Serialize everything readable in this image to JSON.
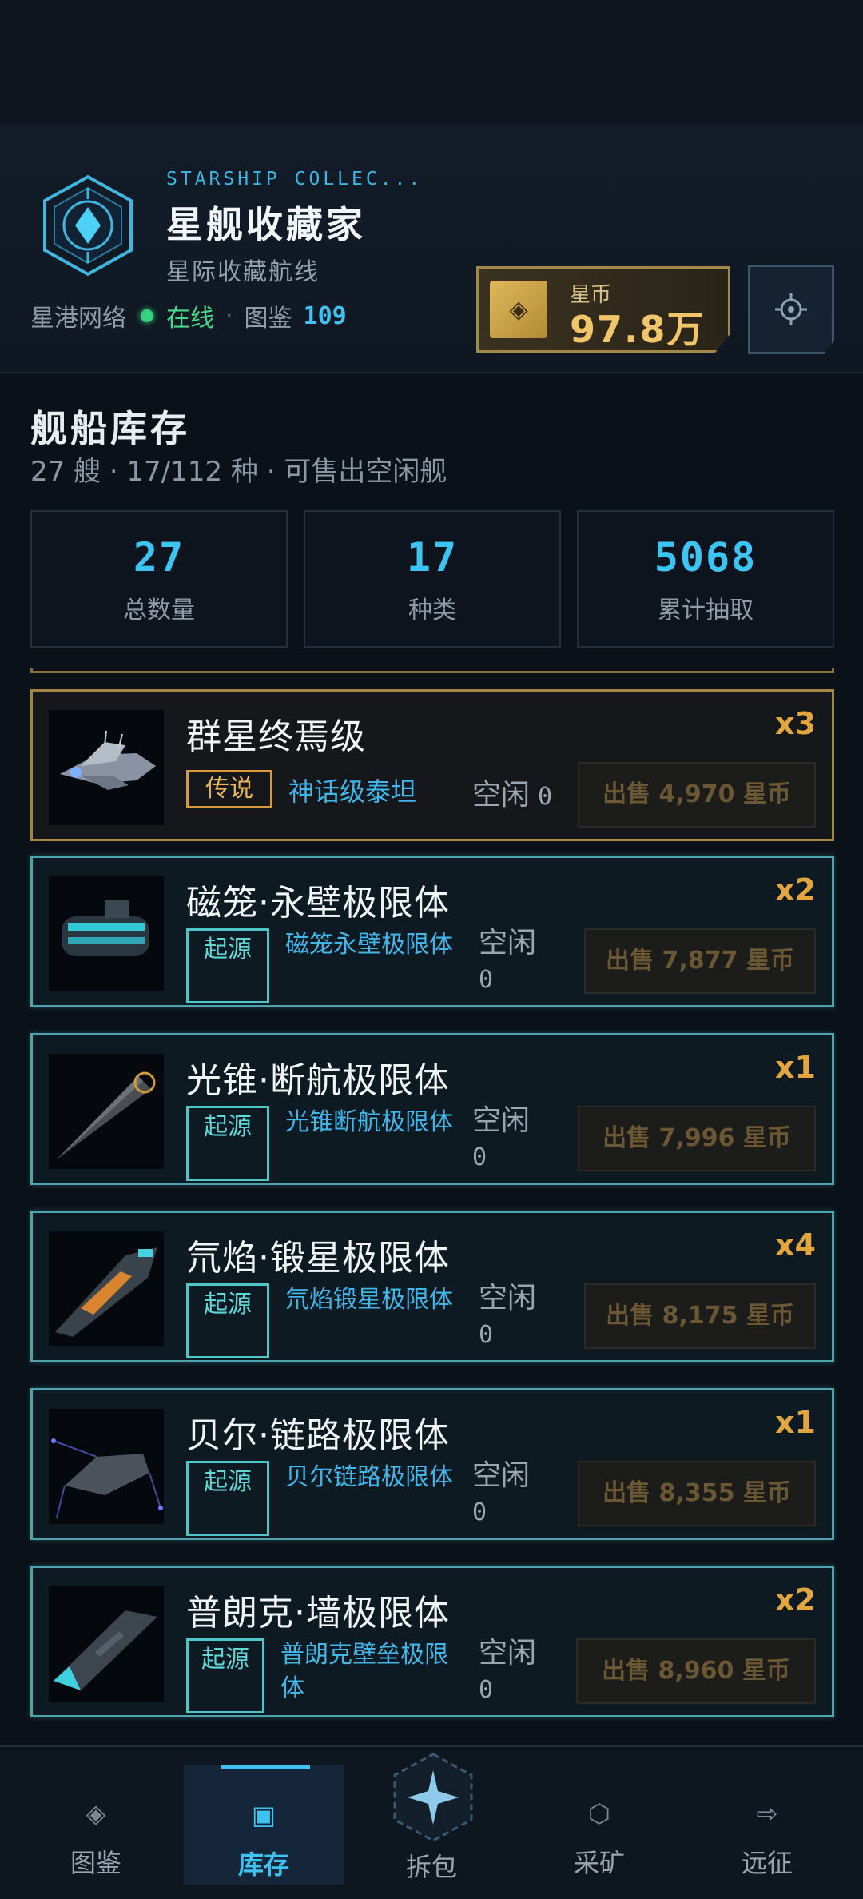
{
  "header": {
    "app_subtitle_en": "STARSHIP COLLEC...",
    "app_title": "星舰收藏家",
    "app_subtitle": "星际收藏航线",
    "network_label": "星港网络",
    "online_label": "在线",
    "separator": "·",
    "catalog_label": "图鉴",
    "catalog_count": "109",
    "coin_label": "星币",
    "coin_value": "97.8万",
    "coin_icon": "diamond-icon",
    "settings_icon": "gear-icon"
  },
  "inventory": {
    "title": "舰船库存",
    "subtitle": "27 艘 · 17/112 种 · 可售出空闲舰",
    "stats": [
      {
        "value": "27",
        "label": "总数量"
      },
      {
        "value": "17",
        "label": "种类"
      },
      {
        "value": "5068",
        "label": "累计抽取"
      }
    ]
  },
  "ships": [
    {
      "name": "群星终焉级",
      "qty": "x3",
      "rarity": "传说",
      "class": "神话级泰坦",
      "idle_label": "空闲",
      "idle": "0",
      "sell": "出售 4,970 星币"
    },
    {
      "name": "磁笼·永壁极限体",
      "qty": "x2",
      "rarity": "起源",
      "class": "磁笼永壁极限体",
      "idle_label": "空闲",
      "idle": "0",
      "sell": "出售 7,877 星币"
    },
    {
      "name": "光锥·断航极限体",
      "qty": "x1",
      "rarity": "起源",
      "class": "光锥断航极限体",
      "idle_label": "空闲",
      "idle": "0",
      "sell": "出售 7,996 星币"
    },
    {
      "name": "氘焰·锻星极限体",
      "qty": "x4",
      "rarity": "起源",
      "class": "氘焰锻星极限体",
      "idle_label": "空闲",
      "idle": "0",
      "sell": "出售 8,175 星币"
    },
    {
      "name": "贝尔·链路极限体",
      "qty": "x1",
      "rarity": "起源",
      "class": "贝尔链路极限体",
      "idle_label": "空闲",
      "idle": "0",
      "sell": "出售 8,355 星币"
    },
    {
      "name": "普朗克·墙极限体",
      "qty": "x2",
      "rarity": "起源",
      "class": "普朗克壁垒极限体",
      "idle_label": "空闲",
      "idle": "0",
      "sell": "出售 8,960 星币"
    }
  ],
  "nav": [
    {
      "label": "图鉴",
      "icon": "diamond-icon"
    },
    {
      "label": "库存",
      "icon": "square-icon"
    },
    {
      "label": "拆包",
      "icon": "star-hex-icon"
    },
    {
      "label": "采矿",
      "icon": "hexagon-icon"
    },
    {
      "label": "远征",
      "icon": "arrow-right-icon"
    }
  ],
  "colors": {
    "accent": "#3ec1f3",
    "gold": "#e3a63f",
    "legend_border": "#a58444",
    "origin_border": "#4ea3ad",
    "online": "#36d17c"
  }
}
